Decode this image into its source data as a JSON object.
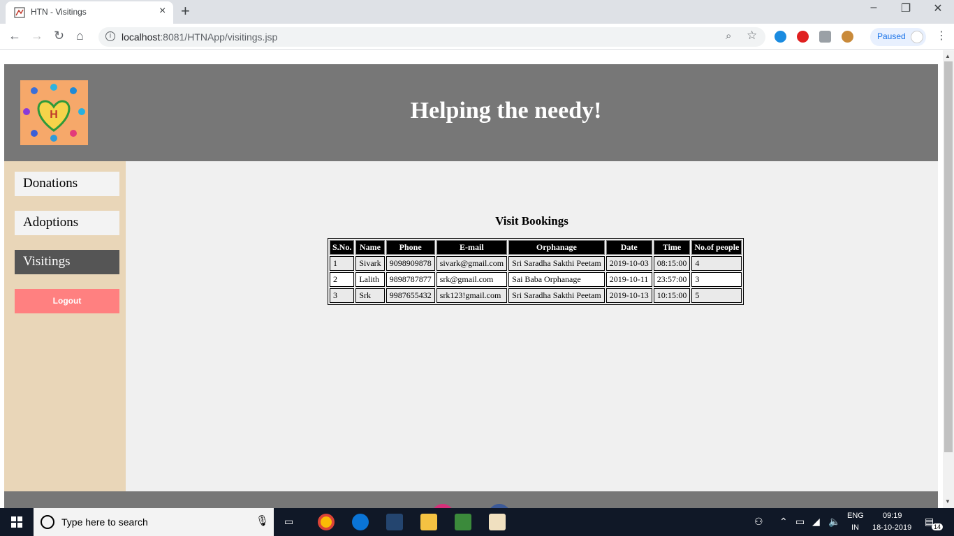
{
  "browser": {
    "tab_title": "HTN - Visitings",
    "url_host": "localhost",
    "url_path": ":8081/HTNApp/visitings.jsp",
    "profile_status": "Paused"
  },
  "site": {
    "title": "Helping the needy!",
    "logo_letter": "H"
  },
  "sidebar": {
    "items": [
      {
        "label": "Donations",
        "active": false
      },
      {
        "label": "Adoptions",
        "active": false
      },
      {
        "label": "Visitings",
        "active": true
      }
    ],
    "logout_label": "Logout"
  },
  "bookings": {
    "title": "Visit Bookings",
    "headers": [
      "S.No.",
      "Name",
      "Phone",
      "E-mail",
      "Orphanage",
      "Date",
      "Time",
      "No.of people"
    ],
    "rows": [
      [
        "1",
        "Sivark",
        "9098909878",
        "sivark@gmail.com",
        "Sri Saradha Sakthi Peetam",
        "2019-10-03",
        "08:15:00",
        "4"
      ],
      [
        "2",
        "Lalith",
        "9898787877",
        "srk@gmail.com",
        "Sai Baba Orphanage",
        "2019-10-11",
        "23:57:00",
        "3"
      ],
      [
        "3",
        "Srk",
        "9987655432",
        "srk123!gmail.com",
        "Sri Saradha Sakthi Peetam",
        "2019-10-13",
        "10:15:00",
        "5"
      ]
    ]
  },
  "taskbar": {
    "search_placeholder": "Type here to search",
    "lang_top": "ENG",
    "lang_bottom": "IN",
    "time": "09:19",
    "date": "18-10-2019",
    "notification_count": "14"
  },
  "colors": {
    "header_bg": "#777777",
    "sidebar_bg": "#e9d6b8",
    "content_bg": "#f0f0f0",
    "active_item_bg": "#555555",
    "logout_bg": "#ff8080"
  }
}
